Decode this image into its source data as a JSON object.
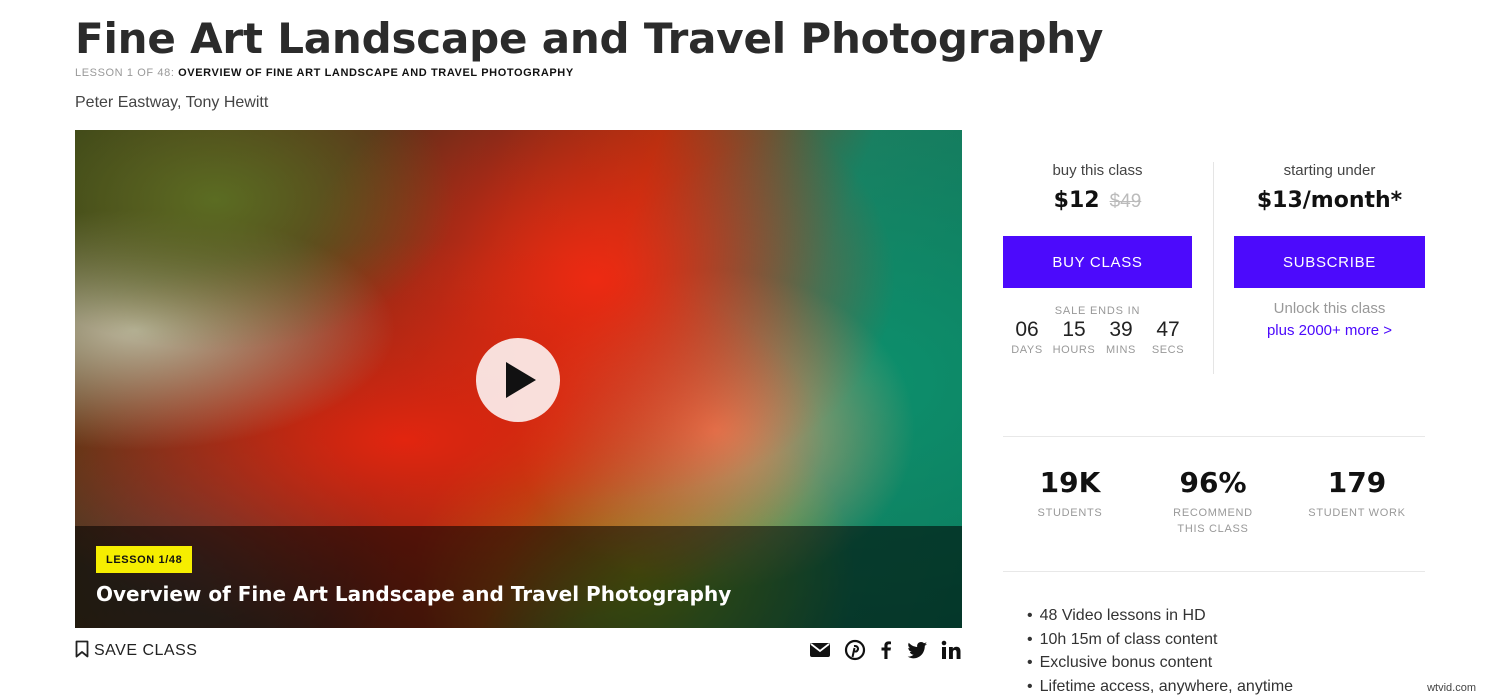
{
  "page": {
    "title": "Fine Art Landscape and Travel Photography",
    "lesson_prefix": "LESSON 1 OF 48:",
    "lesson_name": "OVERVIEW OF FINE ART LANDSCAPE AND TRAVEL PHOTOGRAPHY",
    "authors": "Peter Eastway, Tony Hewitt"
  },
  "video": {
    "badge": "LESSON 1/48",
    "title": "Overview of Fine Art Landscape and Travel Photography",
    "play_icon": "play-icon"
  },
  "actions": {
    "save_label": "SAVE CLASS",
    "share_icons": [
      "email-icon",
      "pinterest-icon",
      "facebook-icon",
      "twitter-icon",
      "linkedin-icon"
    ]
  },
  "buy": {
    "heading": "buy this class",
    "price": "$12",
    "original_price": "$49",
    "button": "BUY CLASS",
    "sale_ends": "SALE ENDS IN",
    "countdown": [
      {
        "value": "06",
        "label": "DAYS"
      },
      {
        "value": "15",
        "label": "HOURS"
      },
      {
        "value": "39",
        "label": "MINS"
      },
      {
        "value": "47",
        "label": "SECS"
      }
    ]
  },
  "subscribe": {
    "heading": "starting under",
    "price": "$13/month*",
    "button": "SUBSCRIBE",
    "unlock": "Unlock this class",
    "more_link": "plus 2000+ more >"
  },
  "stats": [
    {
      "value": "19K",
      "label": "STUDENTS"
    },
    {
      "value": "96%",
      "label": "RECOMMEND THIS CLASS"
    },
    {
      "value": "179",
      "label": "STUDENT WORK"
    }
  ],
  "features": [
    "48 Video lessons in HD",
    "10h 15m of class content",
    "Exclusive bonus content",
    "Lifetime access, anywhere, anytime"
  ],
  "watermark": "wtvid.com",
  "colors": {
    "accent": "#4c0afc",
    "badge": "#f6ee00"
  }
}
